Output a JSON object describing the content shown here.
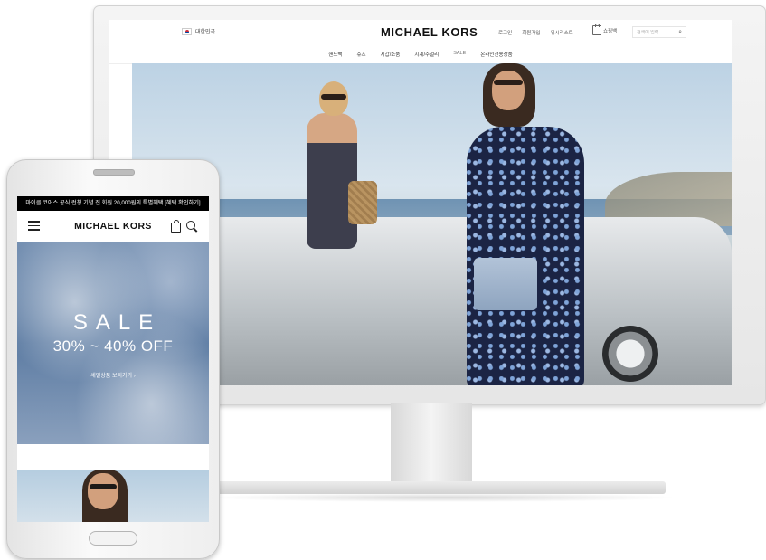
{
  "desktop": {
    "country": "대한민국",
    "logo": "MICHAEL KORS",
    "util_links": [
      "로그인",
      "회원가입",
      "위시리스트"
    ],
    "bag_label": "쇼핑백",
    "search_placeholder": "검색어 입력",
    "nav": [
      "핸드백",
      "슈즈",
      "지갑/소품",
      "시계/주얼리",
      "SALE",
      "온라인전용상품"
    ]
  },
  "mobile": {
    "banner": "마이클 코어스 공식 런칭 기념 전 회원 20,000원의 특별혜택 [혜택 확인하기]",
    "logo": "MICHAEL KORS",
    "sale_title": "SALE",
    "sale_sub": "30% ~ 40% OFF",
    "sale_link": "세일상품 보러가기 ›"
  },
  "colors": {
    "banner_bg": "#000000",
    "sale_bg": "#6f8bb0",
    "text_dark": "#111111"
  }
}
